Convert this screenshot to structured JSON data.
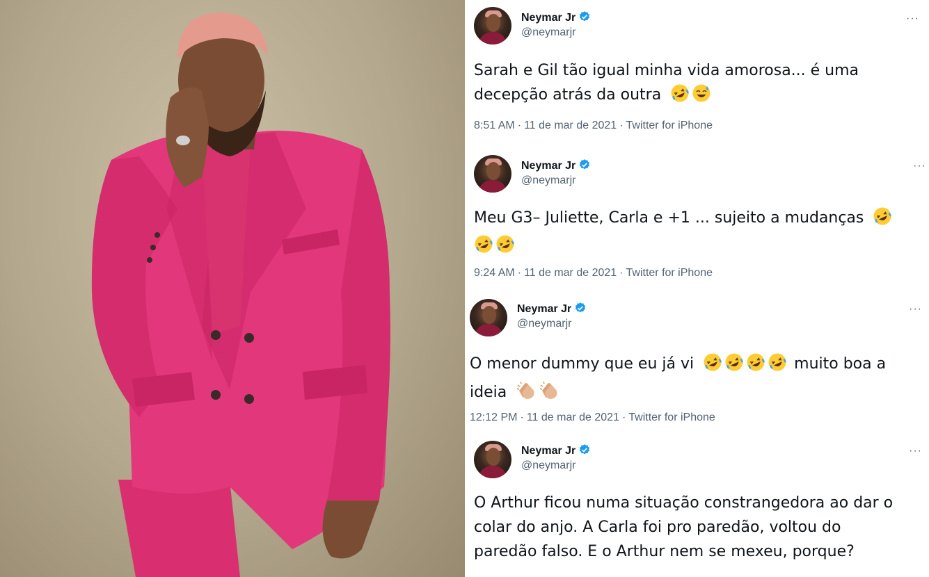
{
  "colors": {
    "suit_pink": "#e2377a",
    "verified_blue": "#1d9bf0",
    "text_primary": "#0f1419",
    "text_secondary": "#536471",
    "photo_background": "#b3a78d"
  },
  "photo": {
    "icon": "photo-person-in-pink-suit"
  },
  "tweets": [
    {
      "display_name": "Neymar Jr",
      "handle": "@neymarjr",
      "text_lines": [
        "Sarah e Gil tão igual minha vida amorosa... é uma",
        "decepção atrás da outra"
      ],
      "emojis": [
        "rofl",
        "sweat-smile"
      ],
      "time": "8:51 AM",
      "date": "11 de mar de 2021",
      "separator": "·",
      "source": "Twitter for iPhone",
      "more": "···"
    },
    {
      "display_name": "Neymar Jr",
      "handle": "@neymarjr",
      "text_lines": [
        "Meu G3– Juliette, Carla e +1 ... sujeito a mudanças"
      ],
      "emojis": [
        "rofl",
        "rofl",
        "rofl"
      ],
      "time": "9:24 AM",
      "date": "11 de mar de 2021",
      "separator": "·",
      "source": "Twitter for iPhone",
      "more": "···"
    },
    {
      "display_name": "Neymar Jr",
      "handle": "@neymarjr",
      "text_lines": [
        "O menor dummy que eu já vi",
        "muito boa a",
        "ideia"
      ],
      "emojis": [
        "rofl",
        "rofl",
        "rofl",
        "rofl",
        "clap",
        "clap"
      ],
      "time": "12:12 PM",
      "date": "11 de mar de 2021",
      "separator": "·",
      "source": "Twitter for iPhone",
      "more": "···"
    },
    {
      "display_name": "Neymar Jr",
      "handle": "@neymarjr",
      "text_lines": [
        "O Arthur ficou numa situação constrangedora ao dar o",
        "colar do anjo. A  Carla foi pro paredão, voltou do",
        "paredão falso. E o Arthur nem se mexeu, porque?"
      ],
      "emojis": [],
      "more": "···"
    }
  ]
}
